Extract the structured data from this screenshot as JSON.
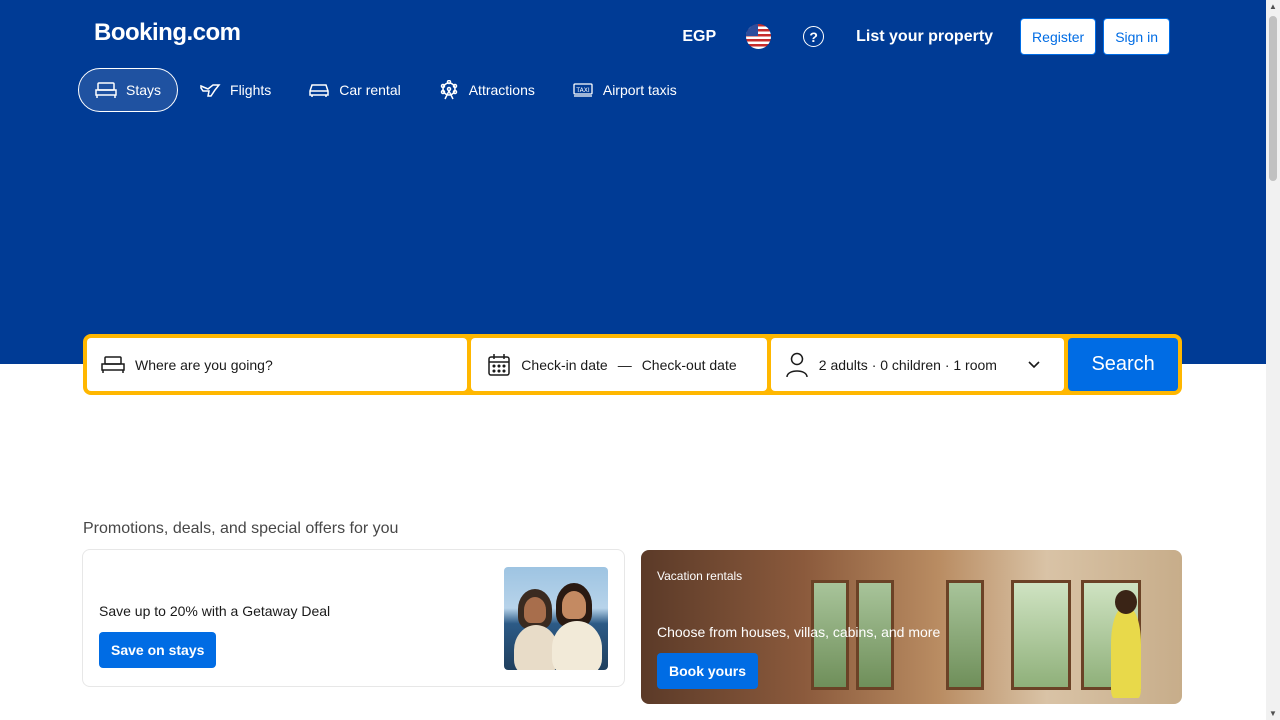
{
  "header": {
    "logo": "Booking.com",
    "currency": "EGP",
    "flag_icon": "us-flag-icon",
    "help_icon": "question-circle-icon",
    "list_property": "List your property",
    "register": "Register",
    "sign_in": "Sign in"
  },
  "nav": {
    "items": [
      {
        "label": "Stays",
        "icon": "bed-icon",
        "active": true
      },
      {
        "label": "Flights",
        "icon": "plane-icon",
        "active": false
      },
      {
        "label": "Car rental",
        "icon": "car-icon",
        "active": false
      },
      {
        "label": "Attractions",
        "icon": "ferris-wheel-icon",
        "active": false
      },
      {
        "label": "Airport taxis",
        "icon": "taxi-icon",
        "active": false
      }
    ]
  },
  "search": {
    "destination_placeholder": "Where are you going?",
    "checkin": "Check-in date",
    "separator": "—",
    "checkout": "Check-out date",
    "guests": "2 adults · 0 children · 1 room",
    "button": "Search"
  },
  "promotions": {
    "title": "Promotions, deals, and special offers for you",
    "card1": {
      "text": "Save up to 20% with a Getaway Deal",
      "button": "Save on stays"
    },
    "card2": {
      "label": "Vacation rentals",
      "text": "Choose from houses, villas, cabins, and more",
      "button": "Book yours"
    }
  },
  "colors": {
    "brand_blue": "#003b95",
    "action_blue": "#006ce4",
    "search_border": "#ffb700"
  }
}
